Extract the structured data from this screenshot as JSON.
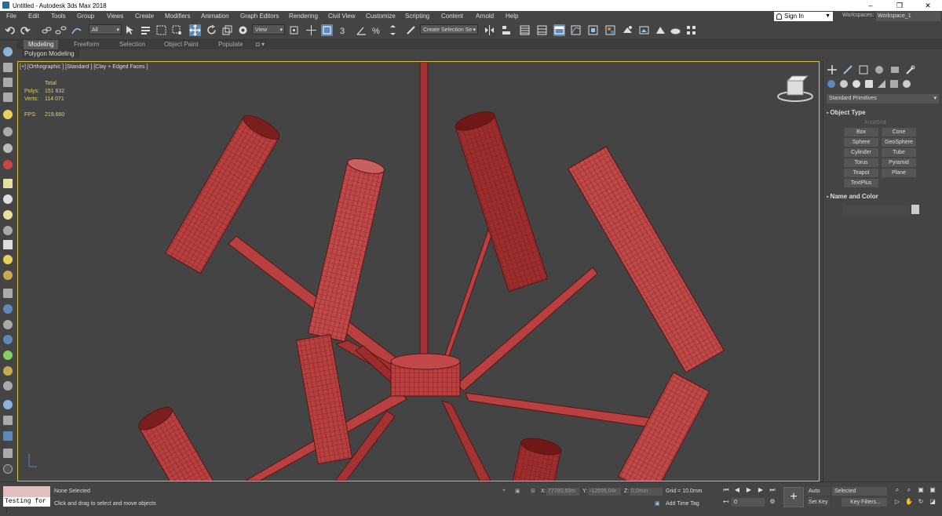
{
  "window": {
    "title": "Untitled - Autodesk 3ds Max 2018",
    "minimize": "–",
    "restore": "❐",
    "close": "✕"
  },
  "menu": {
    "items": [
      "File",
      "Edit",
      "Tools",
      "Group",
      "Views",
      "Create",
      "Modifiers",
      "Animation",
      "Graph Editors",
      "Rendering",
      "Civil View",
      "Customize",
      "Scripting",
      "Content",
      "Arnold",
      "Help"
    ],
    "sign_in": "Sign In",
    "workspaces_label": "Workspaces:",
    "workspace_value": "Workspace_1"
  },
  "toolbar": {
    "filter_value": "All",
    "ref_coord_value": "View",
    "selection_set_value": "Create Selection Se"
  },
  "ribbon": {
    "tabs": [
      "Modeling",
      "Freeform",
      "Selection",
      "Object Paint",
      "Populate"
    ],
    "panel_label": "Polygon Modeling"
  },
  "viewport": {
    "label": "[+] [Orthographic ] [Standard ] [Clay + Edged Faces ]",
    "stats": {
      "total_label": "Total",
      "polys_label": "Polys:",
      "polys_value": "151 832",
      "verts_label": "Verts:",
      "verts_value": "114 071",
      "fps_label": "FPS:",
      "fps_value": "219,660"
    }
  },
  "command_panel": {
    "dropdown": "Standard Primitives",
    "object_type_title": "Object Type",
    "autogrid_label": "AutoGrid",
    "buttons": [
      "Box",
      "Cone",
      "Sphere",
      "GeoSphere",
      "Cylinder",
      "Tube",
      "Torus",
      "Pyramid",
      "Teapot",
      "Plane",
      "TextPlus"
    ],
    "name_color_title": "Name and Color"
  },
  "status": {
    "maxscript_input": "Testing for :",
    "selection_status": "None Selected",
    "prompt": "Click and drag to select and move objects",
    "x_label": "X:",
    "x_value": "77780,69m",
    "y_label": "Y:",
    "y_value": "-12695,04r",
    "z_label": "Z:",
    "z_value": "0,0mm",
    "grid": "Grid = 10,0mm",
    "add_time_tag": "Add Time Tag",
    "auto_key": "Auto Key",
    "set_key": "Set Key",
    "selected_dropdown": "Selected",
    "key_filters": "Key Filters...",
    "frame_value": "0"
  },
  "colors": {
    "viewport_bg": "#444444",
    "viewport_border": "#e0c040",
    "stats_text": "#e6d24a",
    "mesh_red": "#b33a3a"
  }
}
